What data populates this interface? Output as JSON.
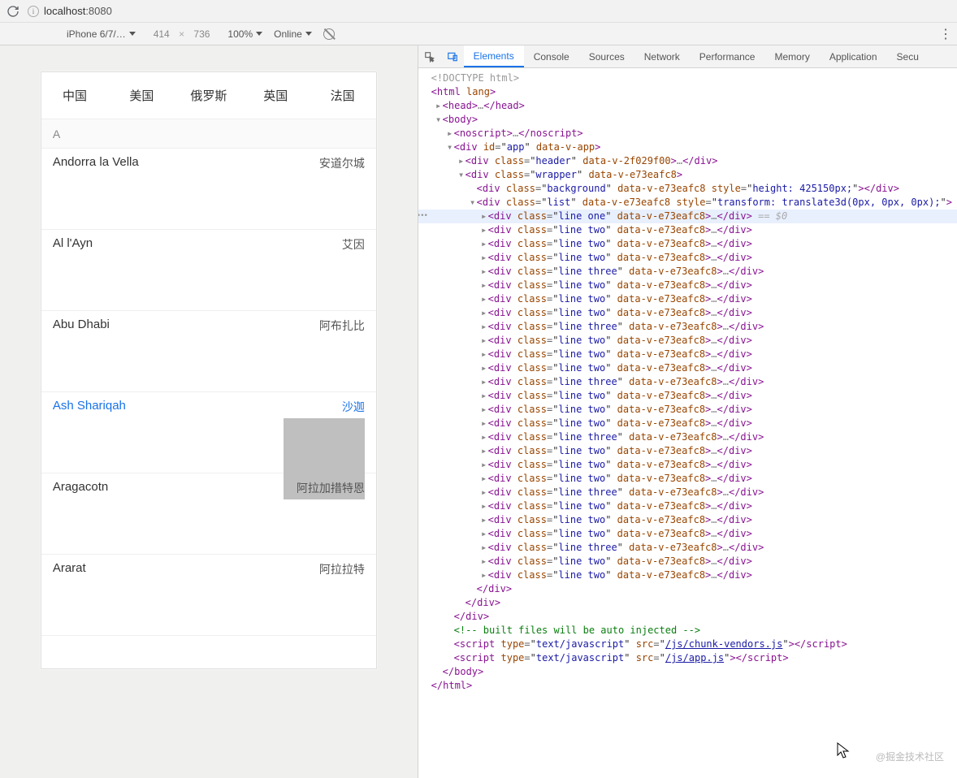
{
  "browser": {
    "url_host": "localhost",
    "url_port": ":8080"
  },
  "device_bar": {
    "device": "iPhone 6/7/…",
    "width": "414",
    "height": "736",
    "zoom": "100%",
    "throttle": "Online"
  },
  "phone": {
    "tabs": [
      "中国",
      "美国",
      "俄罗斯",
      "英国",
      "法国"
    ],
    "section": "A",
    "rows": [
      {
        "en": "Andorra la Vella",
        "cn": "安道尔城",
        "selected": false,
        "thumb": false
      },
      {
        "en": "Al l'Ayn",
        "cn": "艾因",
        "selected": false,
        "thumb": false
      },
      {
        "en": "Abu Dhabi",
        "cn": "阿布扎比",
        "selected": false,
        "thumb": false
      },
      {
        "en": "Ash Shariqah",
        "cn": "沙迦",
        "selected": true,
        "thumb": true
      },
      {
        "en": "Aragacotn",
        "cn": "阿拉加措特恩",
        "selected": false,
        "thumb": false
      },
      {
        "en": "Ararat",
        "cn": "阿拉拉特",
        "selected": false,
        "thumb": false
      }
    ]
  },
  "devtools": {
    "tabs": [
      "Elements",
      "Console",
      "Sources",
      "Network",
      "Performance",
      "Memory",
      "Application",
      "Secu"
    ],
    "active_tab": "Elements",
    "dom": [
      {
        "ind": 0,
        "tw": "",
        "type": "doctype",
        "text": "<!DOCTYPE html>"
      },
      {
        "ind": 0,
        "tw": "",
        "type": "open",
        "tag": "html",
        "attrs": [
          [
            "lang",
            ""
          ]
        ]
      },
      {
        "ind": 1,
        "tw": "▸",
        "type": "collapsed",
        "tag": "head"
      },
      {
        "ind": 1,
        "tw": "▾",
        "type": "open",
        "tag": "body"
      },
      {
        "ind": 2,
        "tw": "▸",
        "type": "collapsed",
        "tag": "noscript"
      },
      {
        "ind": 2,
        "tw": "▾",
        "type": "open",
        "tag": "div",
        "attrs": [
          [
            "id",
            "app"
          ],
          [
            "data-v-app",
            ""
          ]
        ]
      },
      {
        "ind": 3,
        "tw": "▸",
        "type": "collapsed",
        "tag": "div",
        "attrs": [
          [
            "class",
            "header"
          ],
          [
            "data-v-2f029f00",
            ""
          ]
        ]
      },
      {
        "ind": 3,
        "tw": "▾",
        "type": "open",
        "tag": "div",
        "attrs": [
          [
            "class",
            "wrapper"
          ],
          [
            "data-v-e73eafc8",
            ""
          ]
        ]
      },
      {
        "ind": 4,
        "tw": "",
        "type": "single",
        "tag": "div",
        "attrs": [
          [
            "class",
            "background"
          ],
          [
            "data-v-e73eafc8",
            ""
          ],
          [
            "style",
            "height: 425150px;"
          ]
        ]
      },
      {
        "ind": 4,
        "tw": "▾",
        "type": "open",
        "tag": "div",
        "attrs": [
          [
            "class",
            "list"
          ],
          [
            "data-v-e73eafc8",
            ""
          ],
          [
            "style",
            "transform: translate3d(0px, 0px, 0px);"
          ]
        ]
      },
      {
        "ind": 5,
        "tw": "▸",
        "type": "collapsed",
        "tag": "div",
        "attrs": [
          [
            "class",
            "line one"
          ],
          [
            "data-v-e73eafc8",
            ""
          ]
        ],
        "hl": true,
        "sel": " == $0"
      },
      {
        "ind": 5,
        "tw": "▸",
        "type": "collapsed",
        "tag": "div",
        "attrs": [
          [
            "class",
            "line two"
          ],
          [
            "data-v-e73eafc8",
            ""
          ]
        ]
      },
      {
        "ind": 5,
        "tw": "▸",
        "type": "collapsed",
        "tag": "div",
        "attrs": [
          [
            "class",
            "line two"
          ],
          [
            "data-v-e73eafc8",
            ""
          ]
        ]
      },
      {
        "ind": 5,
        "tw": "▸",
        "type": "collapsed",
        "tag": "div",
        "attrs": [
          [
            "class",
            "line two"
          ],
          [
            "data-v-e73eafc8",
            ""
          ]
        ]
      },
      {
        "ind": 5,
        "tw": "▸",
        "type": "collapsed",
        "tag": "div",
        "attrs": [
          [
            "class",
            "line three"
          ],
          [
            "data-v-e73eafc8",
            ""
          ]
        ]
      },
      {
        "ind": 5,
        "tw": "▸",
        "type": "collapsed",
        "tag": "div",
        "attrs": [
          [
            "class",
            "line two"
          ],
          [
            "data-v-e73eafc8",
            ""
          ]
        ]
      },
      {
        "ind": 5,
        "tw": "▸",
        "type": "collapsed",
        "tag": "div",
        "attrs": [
          [
            "class",
            "line two"
          ],
          [
            "data-v-e73eafc8",
            ""
          ]
        ]
      },
      {
        "ind": 5,
        "tw": "▸",
        "type": "collapsed",
        "tag": "div",
        "attrs": [
          [
            "class",
            "line two"
          ],
          [
            "data-v-e73eafc8",
            ""
          ]
        ]
      },
      {
        "ind": 5,
        "tw": "▸",
        "type": "collapsed",
        "tag": "div",
        "attrs": [
          [
            "class",
            "line three"
          ],
          [
            "data-v-e73eafc8",
            ""
          ]
        ]
      },
      {
        "ind": 5,
        "tw": "▸",
        "type": "collapsed",
        "tag": "div",
        "attrs": [
          [
            "class",
            "line two"
          ],
          [
            "data-v-e73eafc8",
            ""
          ]
        ]
      },
      {
        "ind": 5,
        "tw": "▸",
        "type": "collapsed",
        "tag": "div",
        "attrs": [
          [
            "class",
            "line two"
          ],
          [
            "data-v-e73eafc8",
            ""
          ]
        ]
      },
      {
        "ind": 5,
        "tw": "▸",
        "type": "collapsed",
        "tag": "div",
        "attrs": [
          [
            "class",
            "line two"
          ],
          [
            "data-v-e73eafc8",
            ""
          ]
        ]
      },
      {
        "ind": 5,
        "tw": "▸",
        "type": "collapsed",
        "tag": "div",
        "attrs": [
          [
            "class",
            "line three"
          ],
          [
            "data-v-e73eafc8",
            ""
          ]
        ]
      },
      {
        "ind": 5,
        "tw": "▸",
        "type": "collapsed",
        "tag": "div",
        "attrs": [
          [
            "class",
            "line two"
          ],
          [
            "data-v-e73eafc8",
            ""
          ]
        ]
      },
      {
        "ind": 5,
        "tw": "▸",
        "type": "collapsed",
        "tag": "div",
        "attrs": [
          [
            "class",
            "line two"
          ],
          [
            "data-v-e73eafc8",
            ""
          ]
        ]
      },
      {
        "ind": 5,
        "tw": "▸",
        "type": "collapsed",
        "tag": "div",
        "attrs": [
          [
            "class",
            "line two"
          ],
          [
            "data-v-e73eafc8",
            ""
          ]
        ]
      },
      {
        "ind": 5,
        "tw": "▸",
        "type": "collapsed",
        "tag": "div",
        "attrs": [
          [
            "class",
            "line three"
          ],
          [
            "data-v-e73eafc8",
            ""
          ]
        ]
      },
      {
        "ind": 5,
        "tw": "▸",
        "type": "collapsed",
        "tag": "div",
        "attrs": [
          [
            "class",
            "line two"
          ],
          [
            "data-v-e73eafc8",
            ""
          ]
        ]
      },
      {
        "ind": 5,
        "tw": "▸",
        "type": "collapsed",
        "tag": "div",
        "attrs": [
          [
            "class",
            "line two"
          ],
          [
            "data-v-e73eafc8",
            ""
          ]
        ]
      },
      {
        "ind": 5,
        "tw": "▸",
        "type": "collapsed",
        "tag": "div",
        "attrs": [
          [
            "class",
            "line two"
          ],
          [
            "data-v-e73eafc8",
            ""
          ]
        ]
      },
      {
        "ind": 5,
        "tw": "▸",
        "type": "collapsed",
        "tag": "div",
        "attrs": [
          [
            "class",
            "line three"
          ],
          [
            "data-v-e73eafc8",
            ""
          ]
        ]
      },
      {
        "ind": 5,
        "tw": "▸",
        "type": "collapsed",
        "tag": "div",
        "attrs": [
          [
            "class",
            "line two"
          ],
          [
            "data-v-e73eafc8",
            ""
          ]
        ]
      },
      {
        "ind": 5,
        "tw": "▸",
        "type": "collapsed",
        "tag": "div",
        "attrs": [
          [
            "class",
            "line two"
          ],
          [
            "data-v-e73eafc8",
            ""
          ]
        ]
      },
      {
        "ind": 5,
        "tw": "▸",
        "type": "collapsed",
        "tag": "div",
        "attrs": [
          [
            "class",
            "line two"
          ],
          [
            "data-v-e73eafc8",
            ""
          ]
        ]
      },
      {
        "ind": 5,
        "tw": "▸",
        "type": "collapsed",
        "tag": "div",
        "attrs": [
          [
            "class",
            "line three"
          ],
          [
            "data-v-e73eafc8",
            ""
          ]
        ]
      },
      {
        "ind": 5,
        "tw": "▸",
        "type": "collapsed",
        "tag": "div",
        "attrs": [
          [
            "class",
            "line two"
          ],
          [
            "data-v-e73eafc8",
            ""
          ]
        ]
      },
      {
        "ind": 5,
        "tw": "▸",
        "type": "collapsed",
        "tag": "div",
        "attrs": [
          [
            "class",
            "line two"
          ],
          [
            "data-v-e73eafc8",
            ""
          ]
        ]
      },
      {
        "ind": 4,
        "tw": "",
        "type": "close",
        "tag": "div"
      },
      {
        "ind": 3,
        "tw": "",
        "type": "close",
        "tag": "div"
      },
      {
        "ind": 2,
        "tw": "",
        "type": "close",
        "tag": "div"
      },
      {
        "ind": 2,
        "tw": "",
        "type": "comment",
        "text": " built files will be auto injected "
      },
      {
        "ind": 2,
        "tw": "",
        "type": "script",
        "src": "/js/chunk-vendors.js"
      },
      {
        "ind": 2,
        "tw": "",
        "type": "script",
        "src": "/js/app.js"
      },
      {
        "ind": 1,
        "tw": "",
        "type": "close",
        "tag": "body"
      },
      {
        "ind": 0,
        "tw": "",
        "type": "close",
        "tag": "html"
      }
    ]
  },
  "watermark": "@掘金技术社区"
}
